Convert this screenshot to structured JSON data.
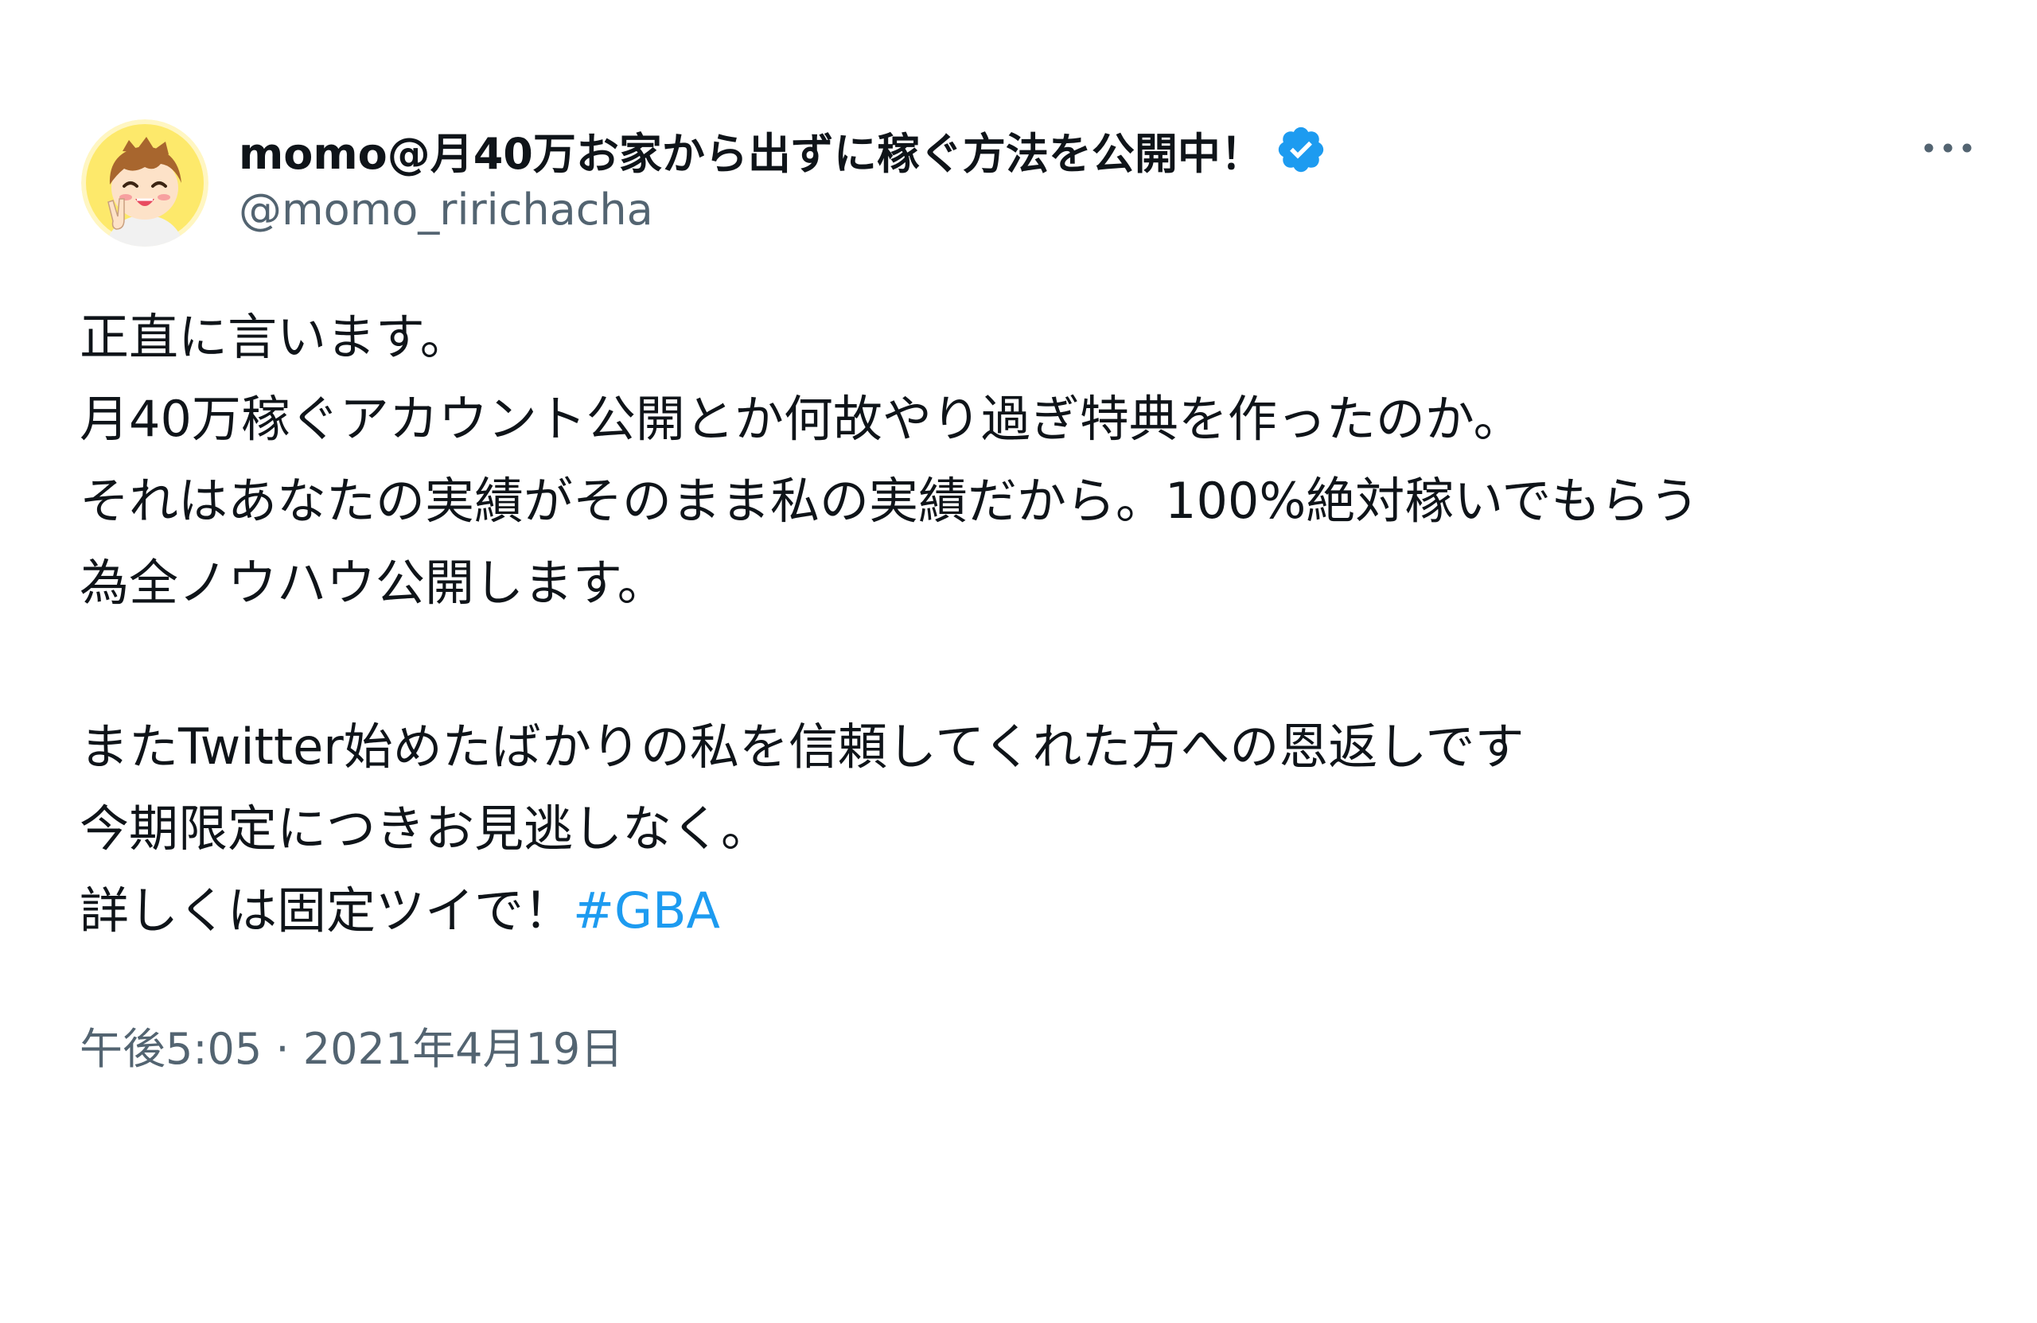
{
  "author": {
    "display_name": "momo@月40万お家から出ずに稼ぐ方法を公開中！",
    "handle": "@momo_ririchacha",
    "verified": true,
    "avatar_icon": "avatar-cartoon-boy"
  },
  "more_icon": "more-dots-icon",
  "tweet": {
    "lines_block1": [
      "正直に言います。",
      "月40万稼ぐアカウント公開とか何故やり過ぎ特典を作ったのか。",
      "それはあなたの実績がそのまま私の実績だから。100%絶対稼いでもらう",
      "為全ノウハウ公開します。"
    ],
    "lines_block2": [
      "またTwitter始めたばかりの私を信頼してくれた方への恩返しです",
      "今期限定につきお見逃しなく。"
    ],
    "last_line_text": "詳しくは固定ツイで！",
    "hashtag": "#GBA"
  },
  "timestamp": "午後5:05 · 2021年4月19日",
  "colors": {
    "text_primary": "#0f1419",
    "text_secondary": "#536471",
    "link": "#1d9bf0",
    "verified_badge": "#1d9bf0"
  }
}
